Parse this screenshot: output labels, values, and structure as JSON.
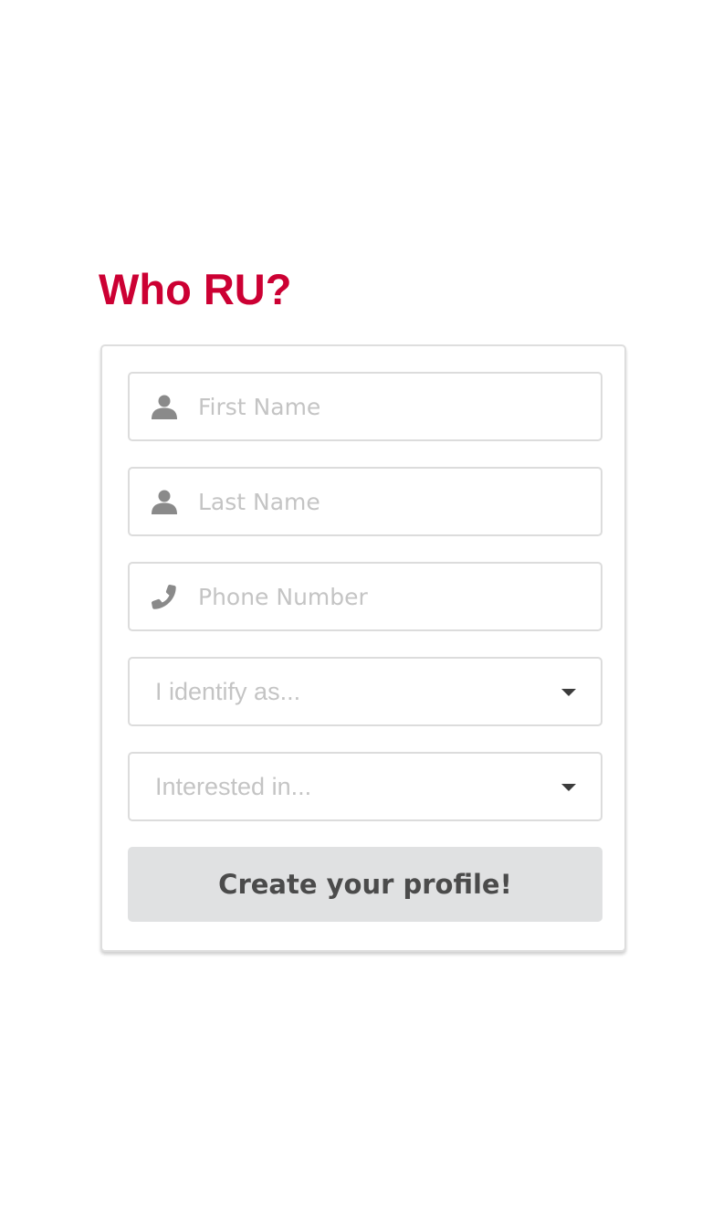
{
  "page": {
    "title": "Who RU?"
  },
  "form": {
    "first_name": {
      "placeholder": "First Name",
      "icon": "user-icon"
    },
    "last_name": {
      "placeholder": "Last Name",
      "icon": "user-icon"
    },
    "phone": {
      "placeholder": "Phone Number",
      "icon": "phone-icon"
    },
    "identify_select": {
      "selected": "I identify as..."
    },
    "interested_select": {
      "selected": "Interested in..."
    },
    "submit_label": "Create your profile!"
  },
  "colors": {
    "title": "#cc0033",
    "button_bg": "#e0e1e2",
    "button_text": "#4b4b4b",
    "placeholder": "#c4c4c4",
    "icon": "#8a8a8a",
    "border": "#dcdcdc"
  }
}
